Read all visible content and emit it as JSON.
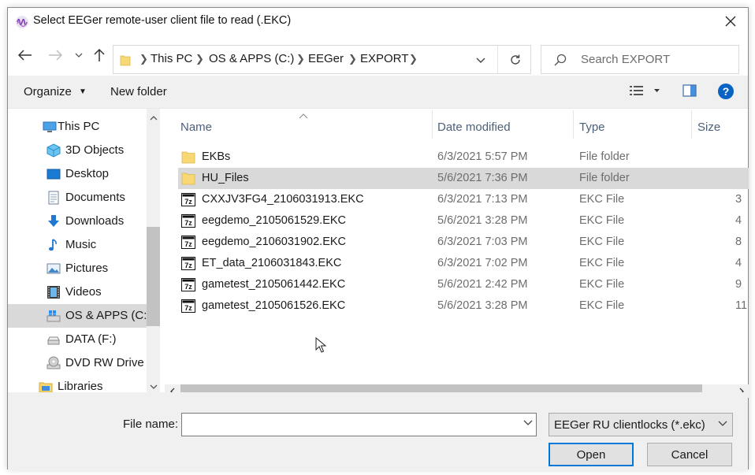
{
  "window": {
    "title": "Select EEGer remote-user client file to read (.EKC)"
  },
  "address": {
    "crumbs": [
      "This PC",
      "OS & APPS (C:)",
      "EEGer",
      "EXPORT"
    ]
  },
  "search": {
    "placeholder": "Search EXPORT"
  },
  "toolbar": {
    "organize_label": "Organize",
    "new_folder_label": "New folder"
  },
  "sidebar": {
    "items": [
      {
        "label": "This PC",
        "icon": "computer-icon"
      },
      {
        "label": "3D Objects",
        "icon": "cube-icon"
      },
      {
        "label": "Desktop",
        "icon": "desktop-icon"
      },
      {
        "label": "Documents",
        "icon": "document-icon"
      },
      {
        "label": "Downloads",
        "icon": "download-icon"
      },
      {
        "label": "Music",
        "icon": "music-icon"
      },
      {
        "label": "Pictures",
        "icon": "picture-icon"
      },
      {
        "label": "Videos",
        "icon": "video-icon"
      },
      {
        "label": "OS & APPS (C:)",
        "icon": "windows-drive-icon"
      },
      {
        "label": "DATA (F:)",
        "icon": "drive-icon"
      },
      {
        "label": "DVD RW Drive",
        "icon": "dvd-icon"
      },
      {
        "label": "Libraries",
        "icon": "library-icon"
      }
    ],
    "selected_index": 8
  },
  "columns": {
    "name": "Name",
    "date": "Date modified",
    "type": "Type",
    "size": "Size"
  },
  "files": [
    {
      "name": "EKBs",
      "date": "6/3/2021 5:57 PM",
      "type": "File folder",
      "size": "",
      "icon": "folder-icon"
    },
    {
      "name": "HU_Files",
      "date": "5/6/2021 7:36 PM",
      "type": "File folder",
      "size": "",
      "icon": "folder-icon"
    },
    {
      "name": "CXXJV3FG4_2106031913.EKC",
      "date": "6/3/2021 7:13 PM",
      "type": "EKC File",
      "size": "3",
      "icon": "7z-file-icon"
    },
    {
      "name": "eegdemo_2105061529.EKC",
      "date": "5/6/2021 3:28 PM",
      "type": "EKC File",
      "size": "4",
      "icon": "7z-file-icon"
    },
    {
      "name": "eegdemo_2106031902.EKC",
      "date": "6/3/2021 7:03 PM",
      "type": "EKC File",
      "size": "8",
      "icon": "7z-file-icon"
    },
    {
      "name": "ET_data_2106031843.EKC",
      "date": "6/3/2021 7:02 PM",
      "type": "EKC File",
      "size": "4",
      "icon": "7z-file-icon"
    },
    {
      "name": "gametest_2105061442.EKC",
      "date": "5/6/2021 2:42 PM",
      "type": "EKC File",
      "size": "9",
      "icon": "7z-file-icon"
    },
    {
      "name": "gametest_2105061526.EKC",
      "date": "5/6/2021 3:28 PM",
      "type": "EKC File",
      "size": "11",
      "icon": "7z-file-icon"
    }
  ],
  "selected_file_index": 1,
  "footer": {
    "filename_label": "File name:",
    "filename_value": "",
    "filter_value": "EEGer RU clientlocks (*.ekc)",
    "open_label": "Open",
    "cancel_label": "Cancel"
  },
  "colors": {
    "accent": "#0078d7",
    "selection": "#d9d9d9",
    "header_text": "#4c607a",
    "folder": "#f8d775"
  }
}
